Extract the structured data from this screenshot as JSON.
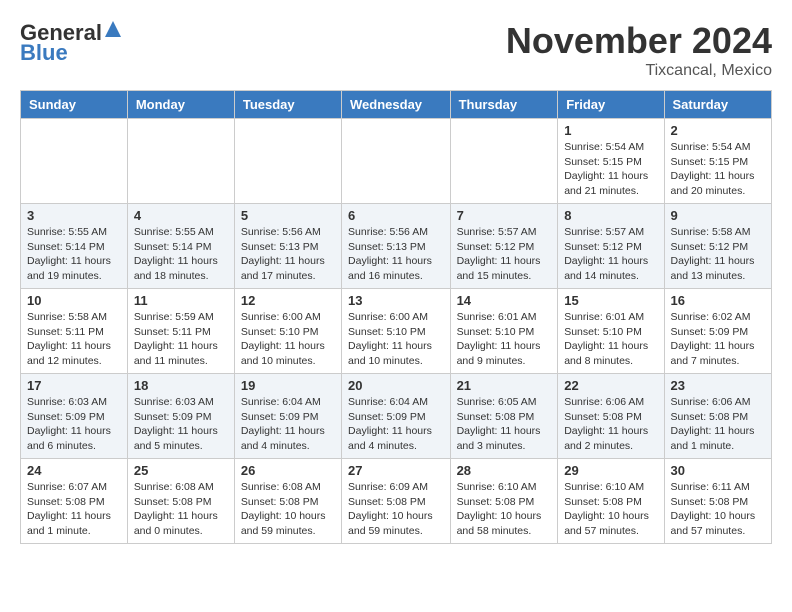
{
  "header": {
    "logo_general": "General",
    "logo_blue": "Blue",
    "month_title": "November 2024",
    "location": "Tixcancal, Mexico"
  },
  "days_of_week": [
    "Sunday",
    "Monday",
    "Tuesday",
    "Wednesday",
    "Thursday",
    "Friday",
    "Saturday"
  ],
  "weeks": [
    [
      {
        "day": "",
        "info": ""
      },
      {
        "day": "",
        "info": ""
      },
      {
        "day": "",
        "info": ""
      },
      {
        "day": "",
        "info": ""
      },
      {
        "day": "",
        "info": ""
      },
      {
        "day": "1",
        "info": "Sunrise: 5:54 AM\nSunset: 5:15 PM\nDaylight: 11 hours and 21 minutes."
      },
      {
        "day": "2",
        "info": "Sunrise: 5:54 AM\nSunset: 5:15 PM\nDaylight: 11 hours and 20 minutes."
      }
    ],
    [
      {
        "day": "3",
        "info": "Sunrise: 5:55 AM\nSunset: 5:14 PM\nDaylight: 11 hours and 19 minutes."
      },
      {
        "day": "4",
        "info": "Sunrise: 5:55 AM\nSunset: 5:14 PM\nDaylight: 11 hours and 18 minutes."
      },
      {
        "day": "5",
        "info": "Sunrise: 5:56 AM\nSunset: 5:13 PM\nDaylight: 11 hours and 17 minutes."
      },
      {
        "day": "6",
        "info": "Sunrise: 5:56 AM\nSunset: 5:13 PM\nDaylight: 11 hours and 16 minutes."
      },
      {
        "day": "7",
        "info": "Sunrise: 5:57 AM\nSunset: 5:12 PM\nDaylight: 11 hours and 15 minutes."
      },
      {
        "day": "8",
        "info": "Sunrise: 5:57 AM\nSunset: 5:12 PM\nDaylight: 11 hours and 14 minutes."
      },
      {
        "day": "9",
        "info": "Sunrise: 5:58 AM\nSunset: 5:12 PM\nDaylight: 11 hours and 13 minutes."
      }
    ],
    [
      {
        "day": "10",
        "info": "Sunrise: 5:58 AM\nSunset: 5:11 PM\nDaylight: 11 hours and 12 minutes."
      },
      {
        "day": "11",
        "info": "Sunrise: 5:59 AM\nSunset: 5:11 PM\nDaylight: 11 hours and 11 minutes."
      },
      {
        "day": "12",
        "info": "Sunrise: 6:00 AM\nSunset: 5:10 PM\nDaylight: 11 hours and 10 minutes."
      },
      {
        "day": "13",
        "info": "Sunrise: 6:00 AM\nSunset: 5:10 PM\nDaylight: 11 hours and 10 minutes."
      },
      {
        "day": "14",
        "info": "Sunrise: 6:01 AM\nSunset: 5:10 PM\nDaylight: 11 hours and 9 minutes."
      },
      {
        "day": "15",
        "info": "Sunrise: 6:01 AM\nSunset: 5:10 PM\nDaylight: 11 hours and 8 minutes."
      },
      {
        "day": "16",
        "info": "Sunrise: 6:02 AM\nSunset: 5:09 PM\nDaylight: 11 hours and 7 minutes."
      }
    ],
    [
      {
        "day": "17",
        "info": "Sunrise: 6:03 AM\nSunset: 5:09 PM\nDaylight: 11 hours and 6 minutes."
      },
      {
        "day": "18",
        "info": "Sunrise: 6:03 AM\nSunset: 5:09 PM\nDaylight: 11 hours and 5 minutes."
      },
      {
        "day": "19",
        "info": "Sunrise: 6:04 AM\nSunset: 5:09 PM\nDaylight: 11 hours and 4 minutes."
      },
      {
        "day": "20",
        "info": "Sunrise: 6:04 AM\nSunset: 5:09 PM\nDaylight: 11 hours and 4 minutes."
      },
      {
        "day": "21",
        "info": "Sunrise: 6:05 AM\nSunset: 5:08 PM\nDaylight: 11 hours and 3 minutes."
      },
      {
        "day": "22",
        "info": "Sunrise: 6:06 AM\nSunset: 5:08 PM\nDaylight: 11 hours and 2 minutes."
      },
      {
        "day": "23",
        "info": "Sunrise: 6:06 AM\nSunset: 5:08 PM\nDaylight: 11 hours and 1 minute."
      }
    ],
    [
      {
        "day": "24",
        "info": "Sunrise: 6:07 AM\nSunset: 5:08 PM\nDaylight: 11 hours and 1 minute."
      },
      {
        "day": "25",
        "info": "Sunrise: 6:08 AM\nSunset: 5:08 PM\nDaylight: 11 hours and 0 minutes."
      },
      {
        "day": "26",
        "info": "Sunrise: 6:08 AM\nSunset: 5:08 PM\nDaylight: 10 hours and 59 minutes."
      },
      {
        "day": "27",
        "info": "Sunrise: 6:09 AM\nSunset: 5:08 PM\nDaylight: 10 hours and 59 minutes."
      },
      {
        "day": "28",
        "info": "Sunrise: 6:10 AM\nSunset: 5:08 PM\nDaylight: 10 hours and 58 minutes."
      },
      {
        "day": "29",
        "info": "Sunrise: 6:10 AM\nSunset: 5:08 PM\nDaylight: 10 hours and 57 minutes."
      },
      {
        "day": "30",
        "info": "Sunrise: 6:11 AM\nSunset: 5:08 PM\nDaylight: 10 hours and 57 minutes."
      }
    ]
  ]
}
